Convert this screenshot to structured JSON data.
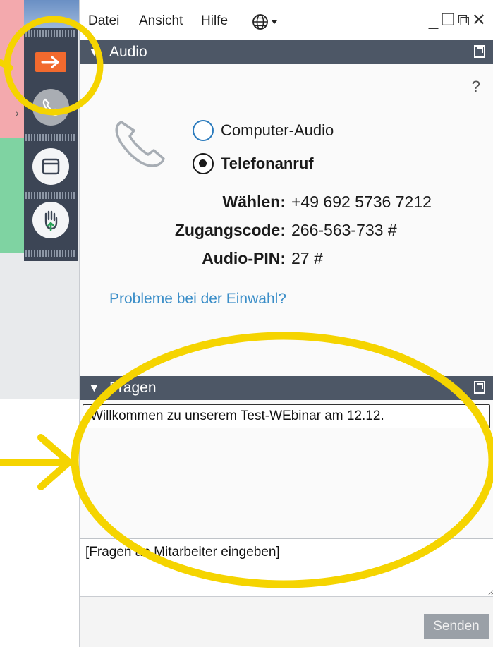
{
  "menu": {
    "datei": "Datei",
    "ansicht": "Ansicht",
    "hilfe": "Hilfe",
    "language_icon": "globe-icon"
  },
  "window_controls": {
    "icons": [
      "minimize-icon",
      "maximize-icon",
      "popout-icon",
      "close-icon"
    ]
  },
  "toolbar": {
    "icons": [
      "arrow-right-icon",
      "phone-icon",
      "window-icon",
      "hand-raise-icon"
    ]
  },
  "audio": {
    "title": "Audio",
    "help": "?",
    "option_computer": "Computer-Audio",
    "option_phone": "Telefonanruf",
    "selected": "Telefonanruf",
    "dial_label": "Wählen:",
    "dial_value": "+49 692 5736 7212",
    "access_label": "Zugangscode:",
    "access_value": "266-563-733 #",
    "pin_label": "Audio-PIN:",
    "pin_value": "27 #",
    "problem_link": "Probleme bei der Einwahl?"
  },
  "questions": {
    "title": "Fragen",
    "message": "Willkommen zu unserem Test-WEbinar am 12.12.",
    "input_value": "[Fragen an Mitarbeiter eingeben]",
    "send": "Senden"
  },
  "colors": {
    "header": "#4d5766",
    "accent": "#f26a2e",
    "highlight": "#f5d400",
    "link": "#3b8ec8"
  }
}
